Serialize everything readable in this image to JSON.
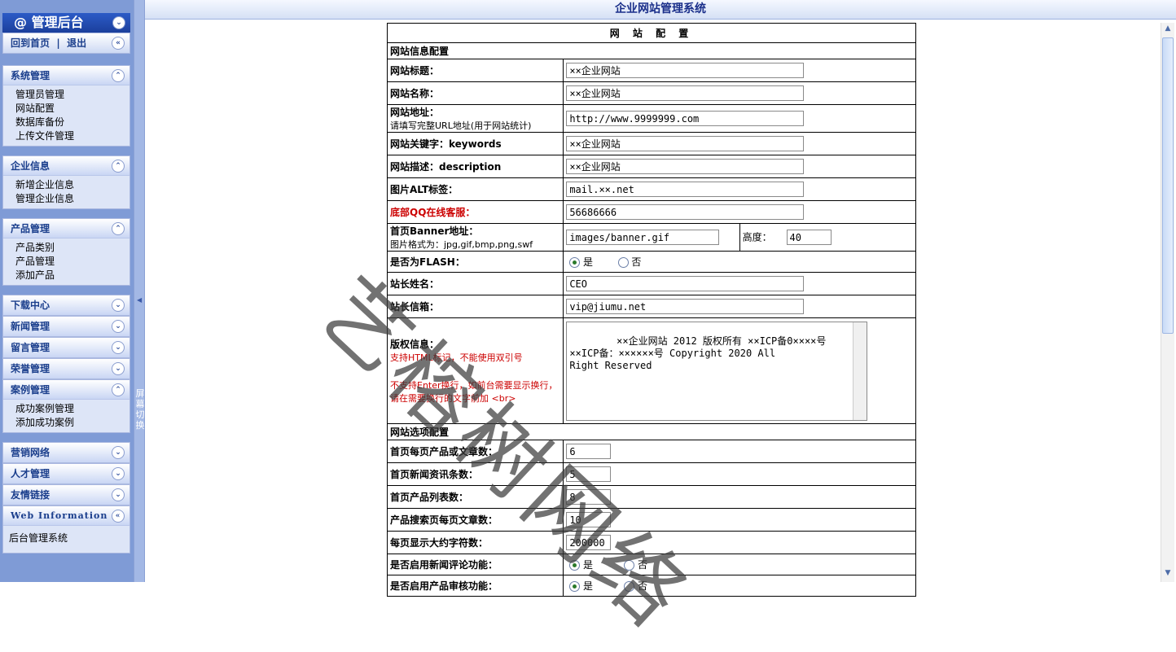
{
  "sidebar": {
    "logo": "@ 管理后台",
    "home_link": "回到首页",
    "logout_link": "退出",
    "sections": [
      {
        "title": "系统管理",
        "expanded": true,
        "items": [
          "管理员管理",
          "网站配置",
          "数据库备份",
          "上传文件管理"
        ]
      },
      {
        "title": "企业信息",
        "expanded": true,
        "items": [
          "新增企业信息",
          "管理企业信息"
        ]
      },
      {
        "title": "产品管理",
        "expanded": true,
        "items": [
          "产品类别",
          "产品管理",
          "添加产品"
        ]
      },
      {
        "title": "下载中心",
        "expanded": false,
        "items": []
      },
      {
        "title": "新闻管理",
        "expanded": false,
        "items": []
      },
      {
        "title": "留言管理",
        "expanded": false,
        "items": []
      },
      {
        "title": "荣誉管理",
        "expanded": false,
        "items": []
      },
      {
        "title": "案例管理",
        "expanded": true,
        "items": [
          "成功案例管理",
          "添加成功案例"
        ]
      },
      {
        "title": "营销网络",
        "expanded": false,
        "items": []
      },
      {
        "title": "人才管理",
        "expanded": false,
        "items": []
      },
      {
        "title": "友情链接",
        "expanded": false,
        "items": []
      },
      {
        "title": "Web Information",
        "expanded": true,
        "items": [
          "后台管理系统"
        ]
      }
    ],
    "switch_label": "屏幕切换"
  },
  "header": {
    "title": "企业网站管理系统"
  },
  "form": {
    "title": "网 站 配 置",
    "section_info": "网站信息配置",
    "site_title_label": "网站标题：",
    "site_title_value": "××企业网站",
    "site_name_label": "网站名称：",
    "site_name_value": "××企业网站",
    "site_url_label": "网站地址：",
    "site_url_note": "请填写完整URL地址(用于网站统计)",
    "site_url_value": "http://www.9999999.com",
    "keywords_label": "网站关键字：keywords",
    "keywords_value": "××企业网站",
    "description_label": "网站描述：description",
    "description_value": "××企业网站",
    "alt_label": "图片ALT标签：",
    "alt_value": "mail.××.net",
    "qq_label": "底部QQ在线客服：",
    "qq_value": "56686666",
    "banner_label": "首页Banner地址：",
    "banner_note": "图片格式为：jpg,gif,bmp,png,swf",
    "banner_value": "images/banner.gif",
    "height_label": "高度：",
    "height_value": "40",
    "flash_label": "是否为FLASH：",
    "flash_yes": "是",
    "flash_no": "否",
    "owner_label": "站长姓名：",
    "owner_value": "CEO",
    "email_label": "站长信箱：",
    "email_value": "vip@jiumu.net",
    "copyright_label": "版权信息：",
    "copyright_note1": "支持HTML标记，不能使用双引号",
    "copyright_note2": "不支持Enter换行，如前台需要显示换行，请在需要换行的文字前加 <br>",
    "copyright_value": "××企业网站 2012 版权所有 ××ICP备0××××号\n××ICP备：××××××号 Copyright 2020 All\nRight Reserved",
    "section_options": "网站选项配置",
    "opt_products_label": "首页每页产品或文章数：",
    "opt_products_value": "6",
    "opt_news_label": "首页新闻资讯条数：",
    "opt_news_value": "5",
    "opt_list_label": "首页产品列表数：",
    "opt_list_value": "8",
    "opt_search_label": "产品搜索页每页文章数：",
    "opt_search_value": "10",
    "opt_chars_label": "每页显示大约字符数：",
    "opt_chars_value": "200000",
    "opt_comment_label": "是否启用新闻评论功能：",
    "opt_comment_yes": "是",
    "opt_comment_no": "否",
    "opt_audit_label": "是否启用产品审核功能：",
    "opt_audit_yes": "是",
    "opt_audit_no": "否"
  },
  "watermark": "艺榕树网络"
}
